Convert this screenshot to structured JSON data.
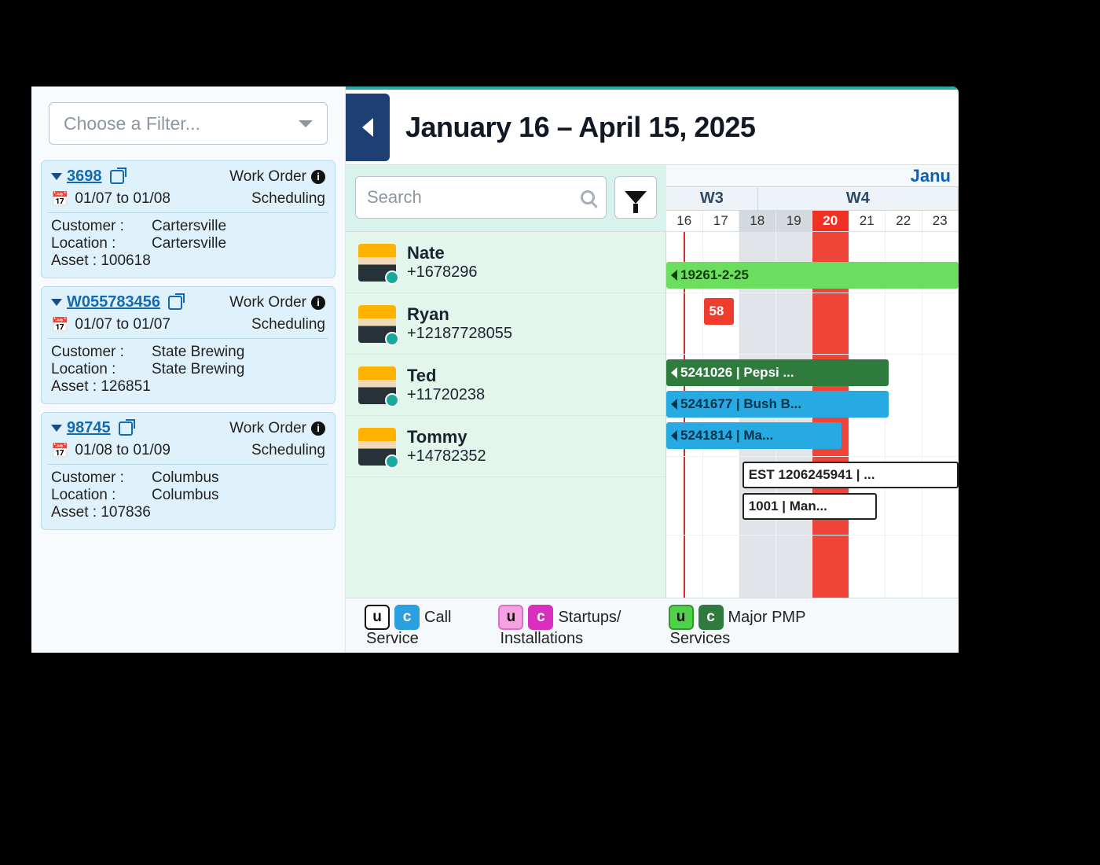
{
  "filter_placeholder": "Choose a Filter...",
  "sidebar": {
    "cards": [
      {
        "id": "3698",
        "type": "Work Order",
        "dates": "01/07 to 01/08",
        "status": "Scheduling",
        "customer_label": "Customer :",
        "customer_value": "Cartersville",
        "location_label": "Location :",
        "location_value": "Cartersville",
        "asset_label": "Asset : 100618"
      },
      {
        "id": "W055783456",
        "type": "Work Order",
        "dates": "01/07 to 01/07",
        "status": "Scheduling",
        "customer_label": "Customer :",
        "customer_value": "State Brewing",
        "location_label": "Location :",
        "location_value": "State Brewing",
        "asset_label": "Asset : 126851"
      },
      {
        "id": "98745",
        "type": "Work Order",
        "dates": "01/08 to 01/09",
        "status": "Scheduling",
        "customer_label": "Customer :",
        "customer_value": "Columbus",
        "location_label": "Location :",
        "location_value": "Columbus",
        "asset_label": "Asset : 107836"
      }
    ]
  },
  "header": {
    "date_range": "January 16 – April 15, 2025"
  },
  "search_placeholder": "Search",
  "timeline": {
    "month_label": "Janu",
    "weeks": [
      "W3",
      "W4"
    ],
    "days": [
      "16",
      "17",
      "18",
      "19",
      "20",
      "21",
      "22",
      "23"
    ]
  },
  "resources": [
    {
      "name": "Nate",
      "phone": "+1678296"
    },
    {
      "name": "Ryan",
      "phone": "+12187728055"
    },
    {
      "name": "Ted",
      "phone": "+11720238"
    },
    {
      "name": "Tommy",
      "phone": "+14782352"
    }
  ],
  "bars": {
    "nate1": "19261-2-25",
    "ryan1": "58",
    "ted1": "5241026 | Pepsi ...",
    "ted2": "5241677 | Bush B...",
    "ted3": "5241814 | Ma...",
    "tom1": "EST 1206245941 | ...",
    "tom2": "1001 | Man..."
  },
  "legend": [
    {
      "top": "Call",
      "sub": "Service"
    },
    {
      "top": "Startups/",
      "sub": "Installations"
    },
    {
      "top": "Major PMP",
      "sub": "Services"
    }
  ],
  "chip_u": "u",
  "chip_c": "c"
}
